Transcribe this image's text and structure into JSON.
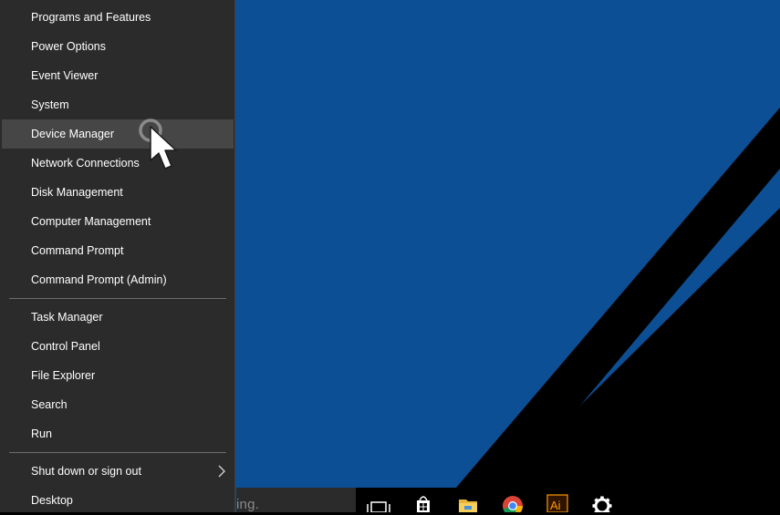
{
  "menu": {
    "groups": [
      {
        "items": [
          {
            "label": "Programs and Features"
          },
          {
            "label": "Power Options"
          },
          {
            "label": "Event Viewer"
          },
          {
            "label": "System"
          },
          {
            "label": "Device Manager",
            "state": "hover"
          },
          {
            "label": "Network Connections"
          },
          {
            "label": "Disk Management"
          },
          {
            "label": "Computer Management"
          },
          {
            "label": "Command Prompt"
          },
          {
            "label": "Command Prompt (Admin)"
          }
        ]
      },
      {
        "items": [
          {
            "label": "Task Manager"
          },
          {
            "label": "Control Panel"
          },
          {
            "label": "File Explorer"
          },
          {
            "label": "Search"
          },
          {
            "label": "Run"
          }
        ]
      },
      {
        "items": [
          {
            "label": "Shut down or sign out",
            "submenu": true
          },
          {
            "label": "Desktop"
          }
        ]
      }
    ]
  },
  "taskbar": {
    "search_text": "ing.",
    "icons": [
      "task-view-icon",
      "store-icon",
      "file-explorer-icon",
      "chrome-icon",
      "illustrator-icon",
      "settings-icon"
    ],
    "illustrator_text": "Ai"
  },
  "colors": {
    "menu_bg": "#2b2b2b",
    "menu_hover": "#464646",
    "desktop_blue": "#0d4f94",
    "taskbar": "#000000"
  }
}
